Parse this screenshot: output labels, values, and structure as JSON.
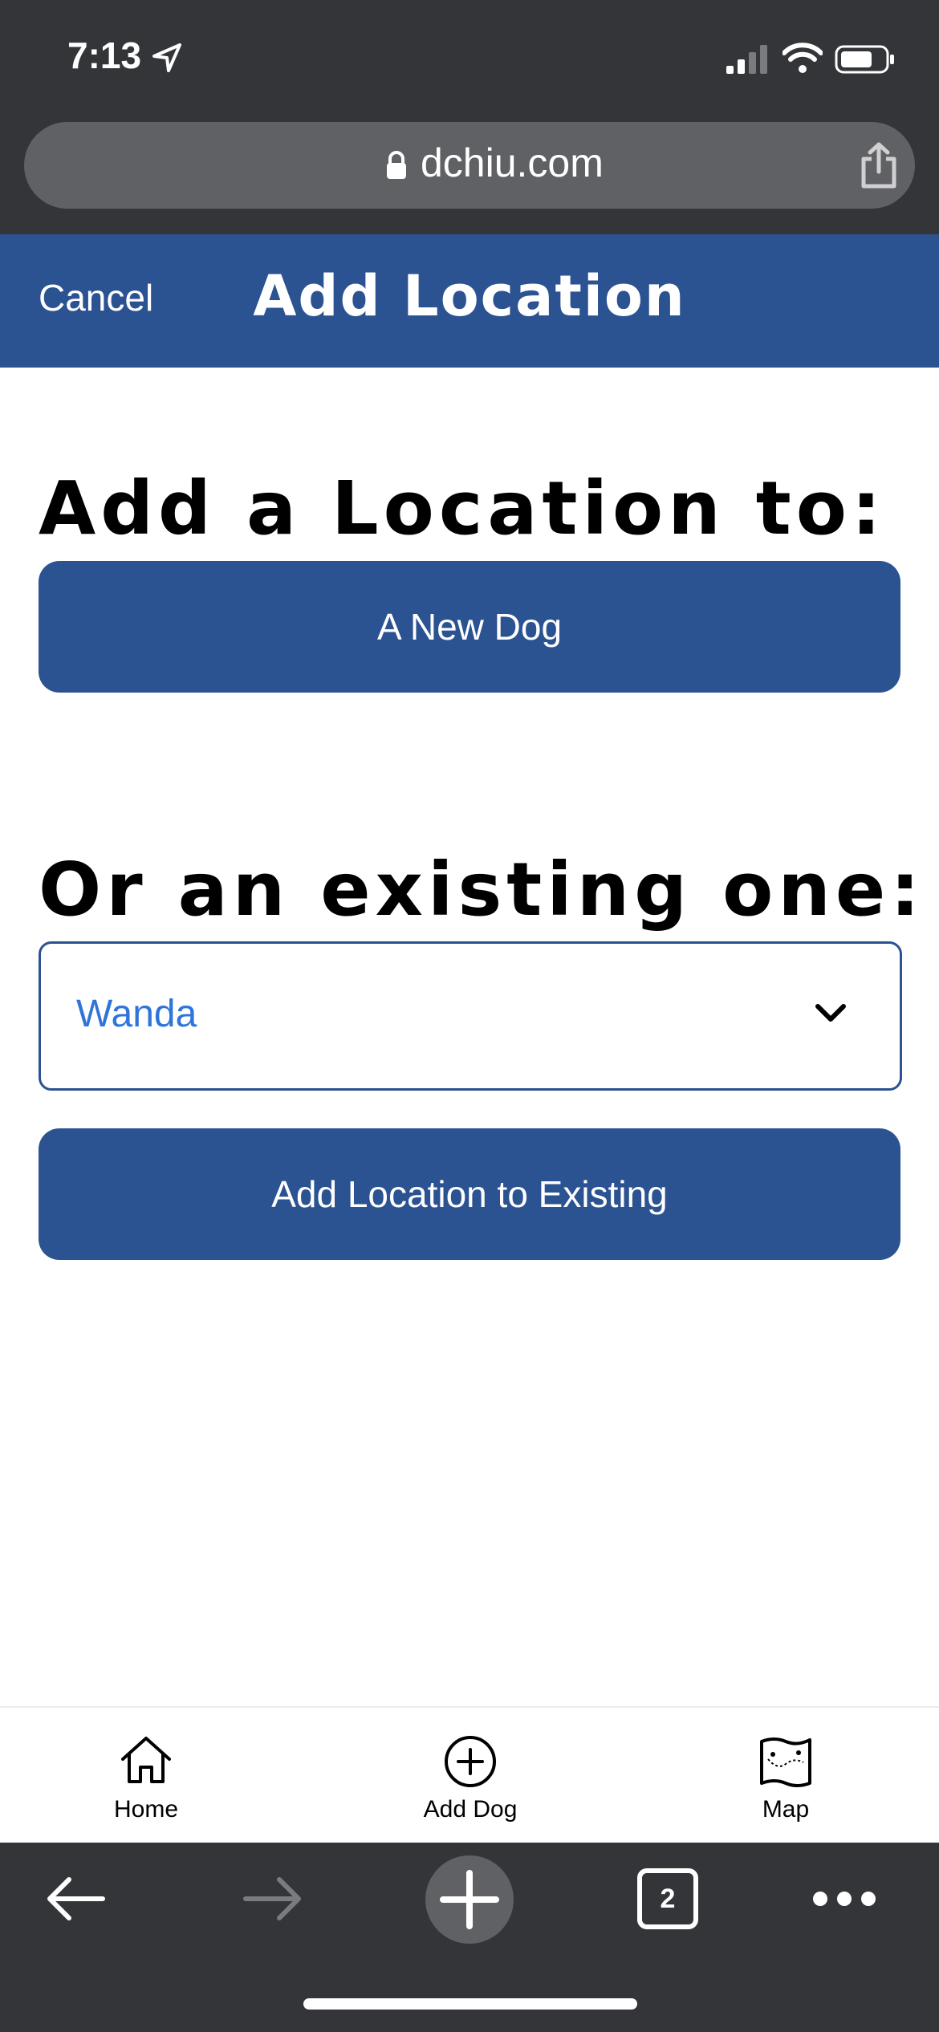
{
  "status_bar": {
    "time": "7:13"
  },
  "browser": {
    "url": "dchiu.com",
    "tab_count": "2"
  },
  "header": {
    "cancel_label": "Cancel",
    "title": "Add Location"
  },
  "main": {
    "heading_new": "Add a Location to:",
    "new_dog_button": "A New Dog",
    "heading_existing": "Or an existing one:",
    "existing_select": {
      "selected": "Wanda"
    },
    "add_existing_button": "Add Location to Existing"
  },
  "tab_bar": {
    "items": [
      {
        "label": "Home",
        "icon": "home-icon"
      },
      {
        "label": "Add Dog",
        "icon": "plus-circle-icon"
      },
      {
        "label": "Map",
        "icon": "map-icon"
      }
    ]
  },
  "colors": {
    "brand": "#2b5291",
    "select_text": "#2f74d8",
    "browser_chrome": "#343539"
  }
}
